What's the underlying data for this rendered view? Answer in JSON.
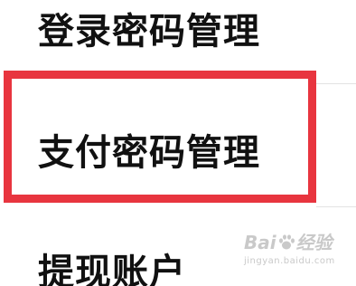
{
  "menu": {
    "items": [
      {
        "label": "登录密码管理"
      },
      {
        "label": "支付密码管理"
      },
      {
        "label": "提现账户"
      }
    ]
  },
  "highlight": {
    "color": "#e8353f"
  },
  "watermark": {
    "brand": "Bai",
    "suffix": "经验",
    "url": "jingyan.baidu.com"
  }
}
